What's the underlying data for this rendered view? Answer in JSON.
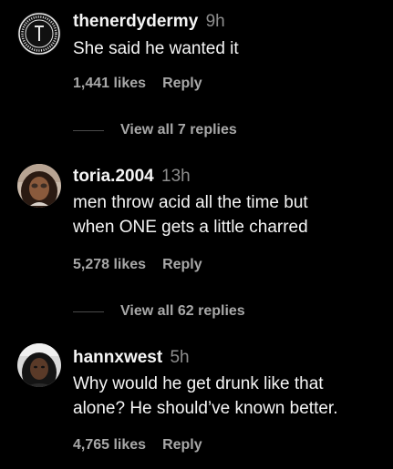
{
  "comments": [
    {
      "username": "thenerdydermy",
      "time": "9h",
      "text": "She said he wanted it",
      "likes": "1,441 likes",
      "reply_label": "Reply",
      "view_replies": "View all 7 replies",
      "avatar": "the-nerdy-dermatologist-logo"
    },
    {
      "username": "toria.2004",
      "time": "13h",
      "text": "men throw acid all the time but\nwhen ONE gets a little charred",
      "likes": "5,278 likes",
      "reply_label": "Reply",
      "view_replies": "View all 62 replies",
      "avatar": "user-photo"
    },
    {
      "username": "hannxwest",
      "time": "5h",
      "text": "Why would he get drunk like that\nalone? He should’ve known better.",
      "likes": "4,765 likes",
      "reply_label": "Reply",
      "avatar": "user-photo"
    }
  ],
  "colors": {
    "background": "#000000",
    "primary_text": "#f5f5f5",
    "secondary_text": "#a8a8a8",
    "timestamp": "#8e8e8e"
  }
}
